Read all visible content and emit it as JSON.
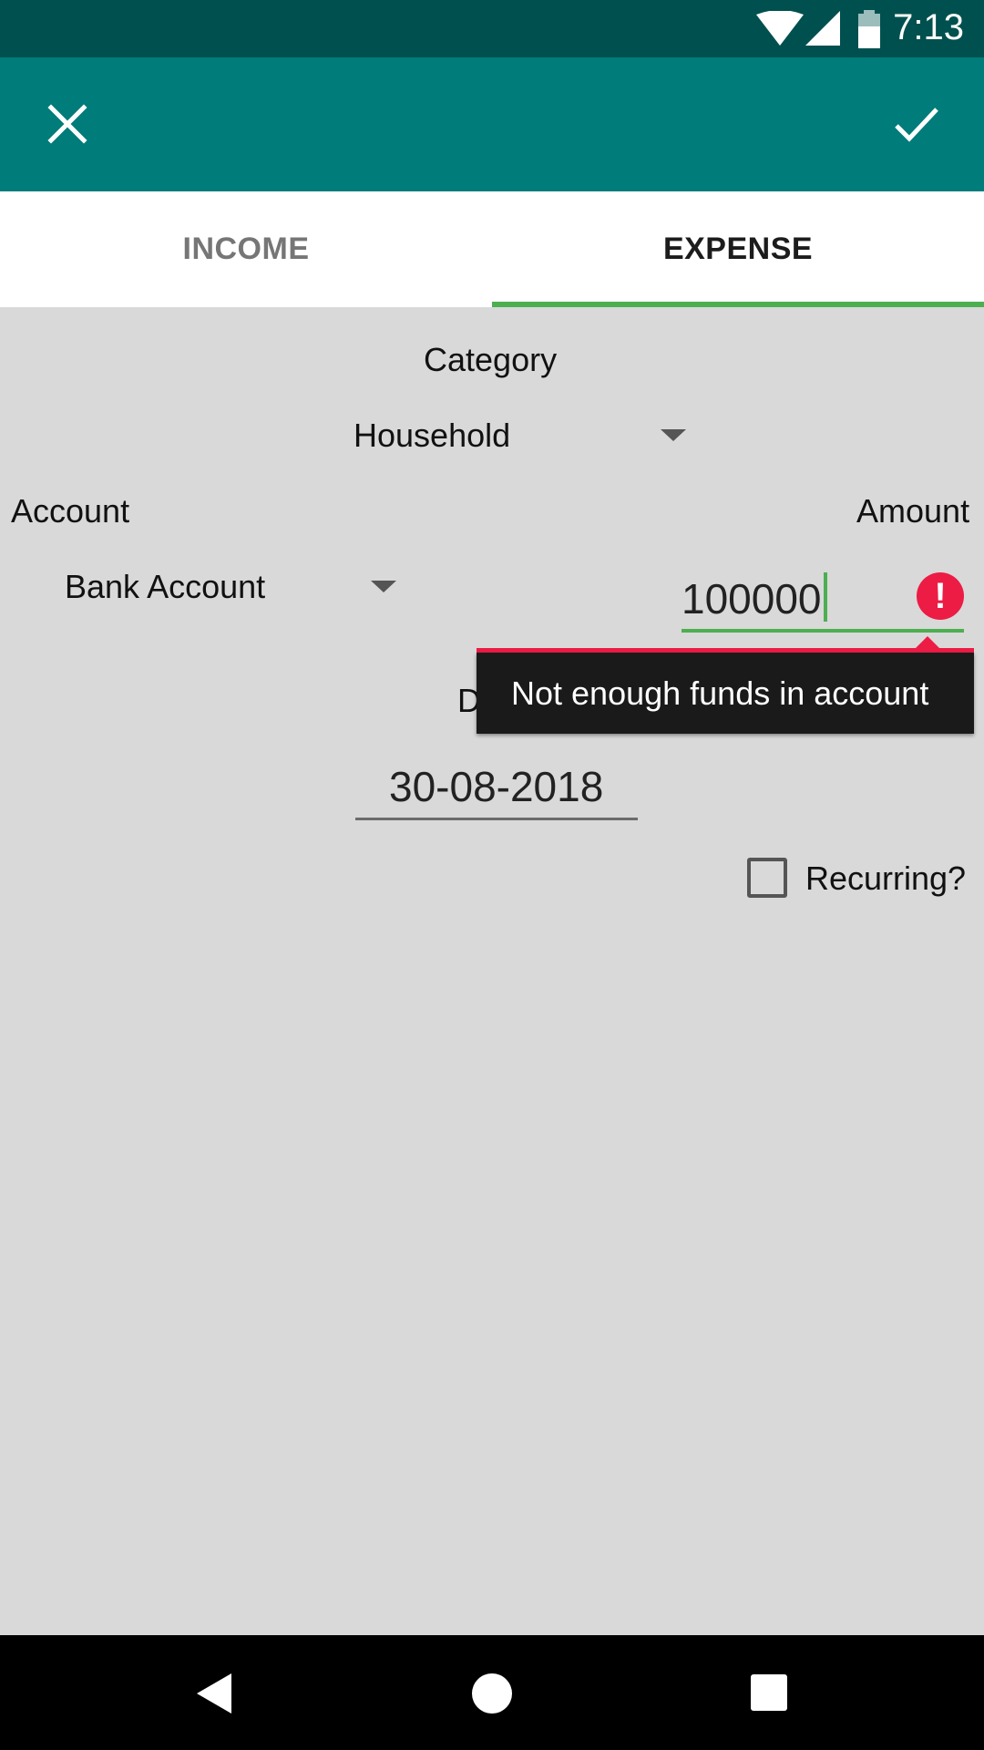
{
  "status_bar": {
    "time": "7:13"
  },
  "tabs": [
    {
      "label": "INCOME",
      "selected": false
    },
    {
      "label": "EXPENSE",
      "selected": true
    }
  ],
  "form": {
    "category_label": "Category",
    "category_value": "Household",
    "account_label": "Account",
    "account_value": "Bank Account",
    "amount_label": "Amount",
    "amount_value": "100000",
    "error_message": "Not enough funds in account",
    "date_label": "Date",
    "date_value": "30-08-2018",
    "recurring_label": "Recurring?",
    "recurring_checked": false
  },
  "colors": {
    "status_bar": "#00504f",
    "app_bar": "#007c7a",
    "accent": "#4caf50",
    "error": "#ec1c45",
    "background": "#d9d9d9"
  },
  "icons": [
    "wifi-icon",
    "signal-icon",
    "battery-icon",
    "close-icon",
    "check-icon",
    "error-icon",
    "back-icon",
    "home-icon",
    "recent-apps-icon"
  ]
}
